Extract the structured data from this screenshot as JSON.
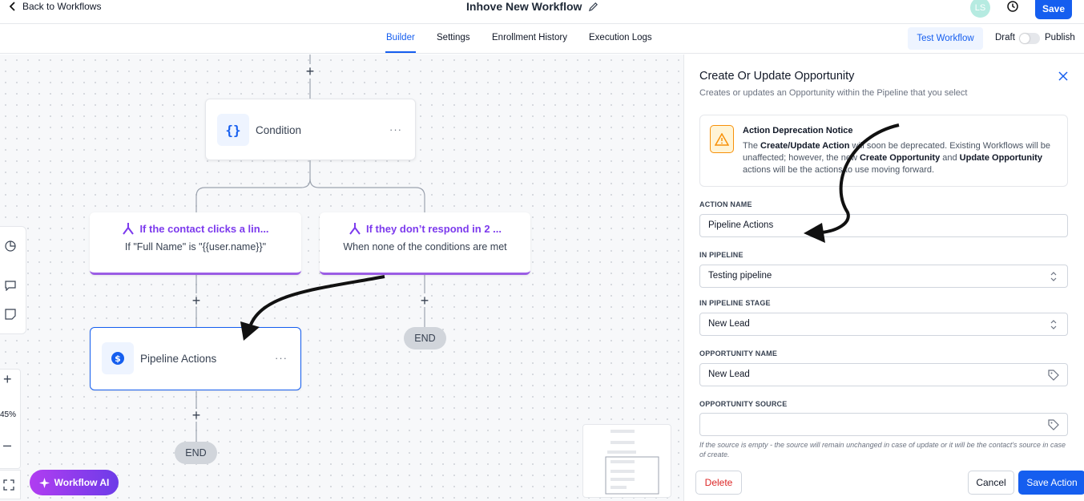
{
  "header": {
    "back_label": "Back to Workflows",
    "workflow_title": "Inhove New Workflow",
    "avatar_initials": "LS",
    "save_label": "Save"
  },
  "tabs": [
    {
      "label": "Builder",
      "active": true
    },
    {
      "label": "Settings",
      "active": false
    },
    {
      "label": "Enrollment History",
      "active": false
    },
    {
      "label": "Execution Logs",
      "active": false
    }
  ],
  "toolbar": {
    "test_label": "Test Workflow",
    "draft_label": "Draft",
    "publish_label": "Publish"
  },
  "canvas": {
    "condition_node": {
      "label": "Condition",
      "menu": "···"
    },
    "branches": [
      {
        "title": "If the contact clicks a lin...",
        "subtitle": "If \"Full Name\" is \"{{user.name}}\""
      },
      {
        "title": "If they don’t respond in 2 ...",
        "subtitle": "When none of the conditions are met"
      }
    ],
    "action_node": {
      "label": "Pipeline Actions",
      "menu": "···"
    },
    "end_label": "END",
    "zoom_level": "45%",
    "ai_button": "Workflow AI"
  },
  "panel": {
    "title": "Create Or Update Opportunity",
    "subtitle": "Creates or updates an Opportunity within the Pipeline that you select",
    "notice": {
      "title": "Action Deprecation Notice",
      "body_1": "The ",
      "body_bold_1": "Create/Update Action",
      "body_2": " will soon be deprecated. Existing Workflows will be unaffected; however, the new ",
      "body_bold_2": "Create Opportunity",
      "body_3": " and ",
      "body_bold_3": "Update Opportunity",
      "body_4": " actions will be the actions to use moving forward."
    },
    "fields": {
      "action_name": {
        "label": "ACTION NAME",
        "value": "Pipeline Actions"
      },
      "pipeline": {
        "label": "IN PIPELINE",
        "value": "Testing pipeline"
      },
      "stage": {
        "label": "IN PIPELINE STAGE",
        "value": "New Lead"
      },
      "opp_name": {
        "label": "OPPORTUNITY NAME",
        "value": "New Lead"
      },
      "opp_source": {
        "label": "OPPORTUNITY SOURCE",
        "value": ""
      }
    },
    "hint": "If the source is empty - the source will remain unchanged in case of update or it will be the contact's source in case of create.",
    "delete_label": "Delete",
    "cancel_label": "Cancel",
    "save_label": "Save Action"
  },
  "colors": {
    "primary": "#155eef",
    "branch_purple": "#7c3aed",
    "danger": "#dc2626",
    "warning": "#f79009"
  }
}
